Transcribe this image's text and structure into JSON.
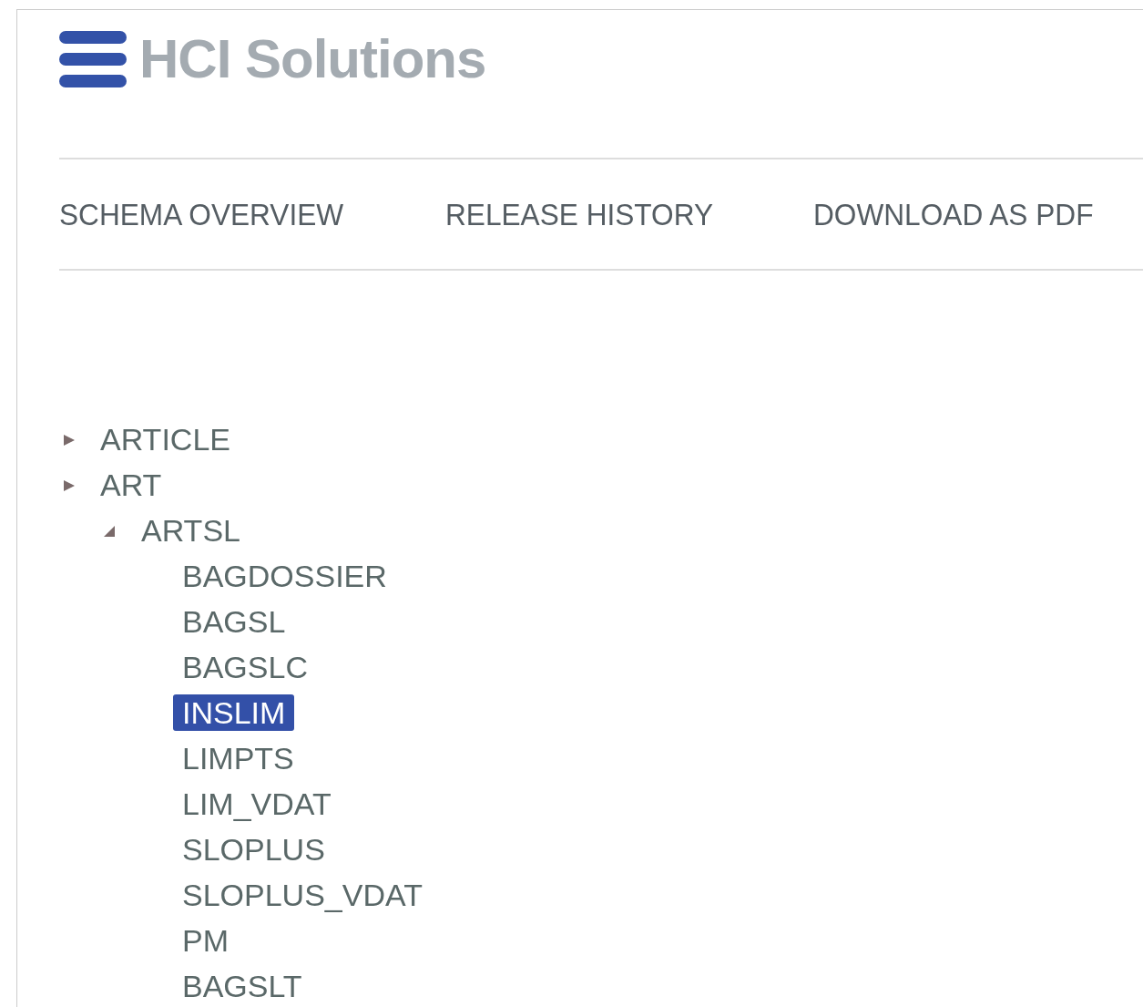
{
  "brand": {
    "name": "HCI Solutions"
  },
  "nav": [
    {
      "label": "SCHEMA OVERVIEW"
    },
    {
      "label": "RELEASE HISTORY"
    },
    {
      "label": "DOWNLOAD AS PDF"
    }
  ],
  "tree": [
    {
      "label": "ARTICLE",
      "expanded": false,
      "selected": false
    },
    {
      "label": "ART",
      "expanded": false,
      "selected": false,
      "children": [
        {
          "label": "ARTSL",
          "expanded": true,
          "selected": false,
          "children": [
            {
              "label": "BAGDOSSIER",
              "selected": false
            },
            {
              "label": "BAGSL",
              "selected": false
            },
            {
              "label": "BAGSLC",
              "selected": false
            },
            {
              "label": "INSLIM",
              "selected": true
            },
            {
              "label": "LIMPTS",
              "selected": false
            },
            {
              "label": "LIM_VDAT",
              "selected": false
            },
            {
              "label": "SLOPLUS",
              "selected": false
            },
            {
              "label": "SLOPLUS_VDAT",
              "selected": false
            },
            {
              "label": "PM",
              "selected": false
            },
            {
              "label": "BAGSLT",
              "selected": false
            }
          ]
        }
      ]
    }
  ]
}
